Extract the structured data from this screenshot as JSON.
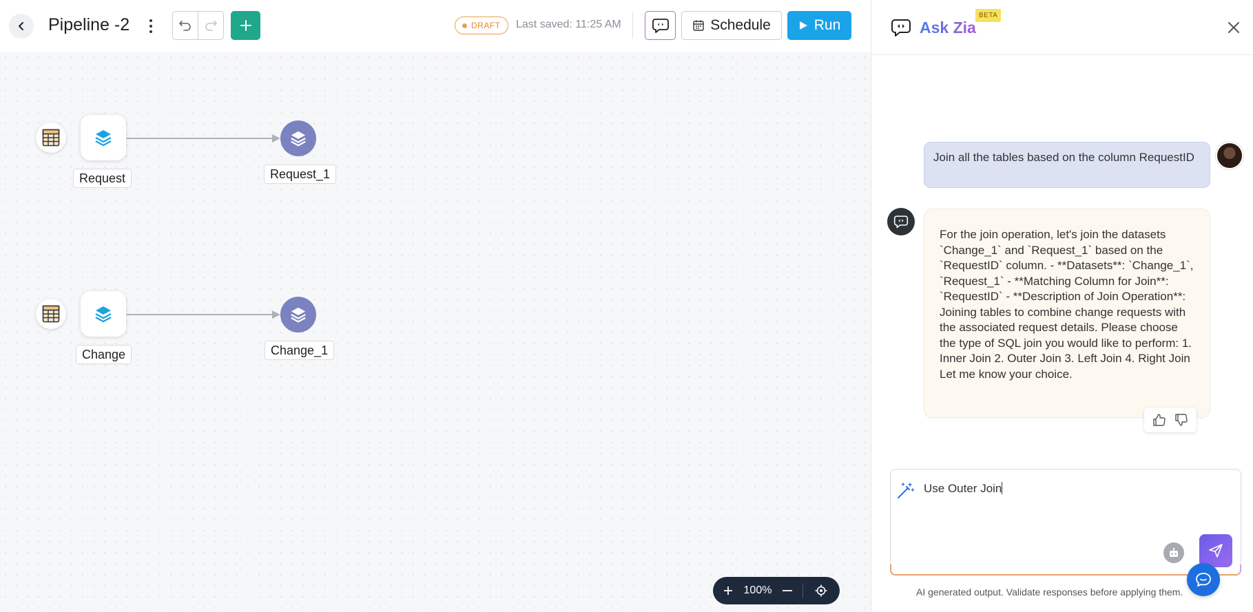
{
  "header": {
    "title": "Pipeline -2",
    "status_badge": "DRAFT",
    "last_saved": "Last saved: 11:25 AM",
    "schedule_label": "Schedule",
    "run_label": "Run"
  },
  "pipeline": {
    "rows": [
      {
        "source_label": "Request",
        "stage_label": "Request_1"
      },
      {
        "source_label": "Change",
        "stage_label": "Change_1"
      }
    ]
  },
  "zoom": {
    "value": "100%"
  },
  "zia": {
    "title": "Ask Zia",
    "beta": "BETA",
    "user_message": "Join all the tables based on the column RequestID",
    "bot_message": "For the join operation, let's join the datasets `Change_1` and `Request_1` based on the `RequestID` column. - **Datasets**: `Change_1`, `Request_1` - **Matching Column for Join**: `RequestID` - **Description of Join Operation**: Joining tables to combine change requests with the associated request details. Please choose the type of SQL join you would like to perform: 1. Inner Join 2. Outer Join 3. Left Join 4. Right Join Let me know your choice.",
    "input_value": "Use Outer Join",
    "disclaimer": "AI generated output. Validate responses before applying them."
  },
  "colors": {
    "accent_green": "#1fa88b",
    "run_blue": "#1aa3e8",
    "stage_purple": "#7a83c0",
    "draft_orange": "#e9a24a"
  },
  "icons": [
    "back-icon",
    "more-icon",
    "undo-icon",
    "redo-icon",
    "plus-icon",
    "zia-icon",
    "calendar-icon",
    "play-icon",
    "table-icon",
    "layers-icon",
    "close-icon",
    "thumbs-up-icon",
    "thumbs-down-icon",
    "magic-wand-icon",
    "robot-icon",
    "send-icon",
    "chat-icon",
    "zoom-in-icon",
    "zoom-out-icon",
    "recenter-icon"
  ]
}
